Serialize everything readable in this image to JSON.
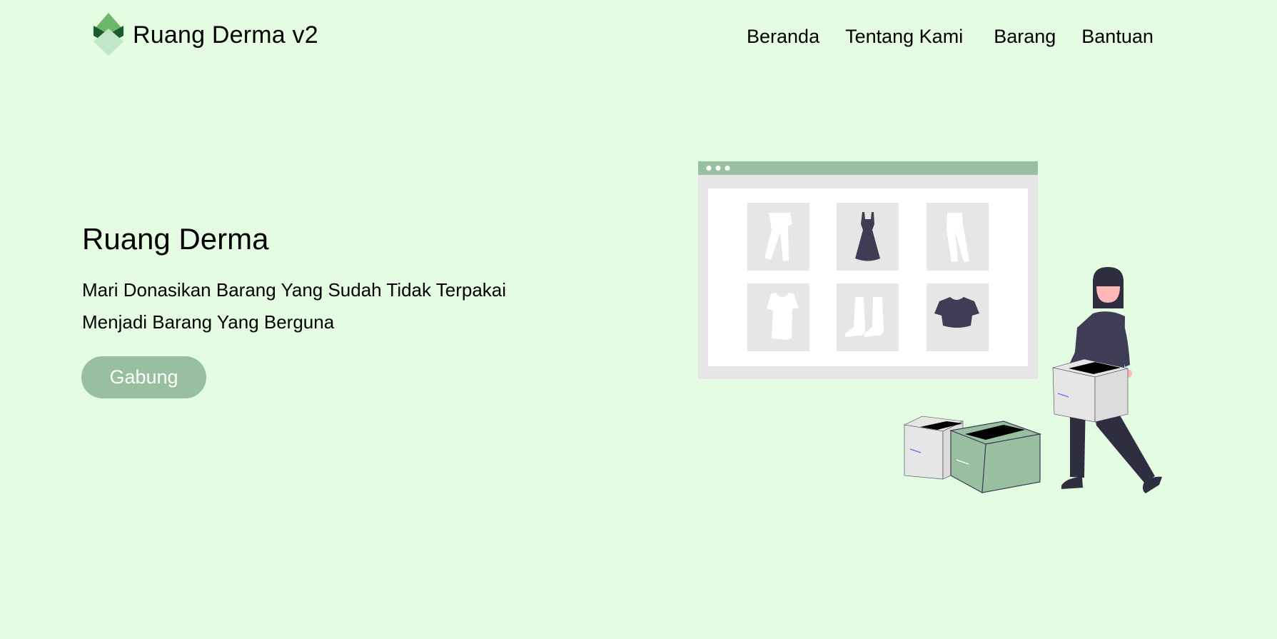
{
  "brand": {
    "name": "Ruang Derma v2",
    "logo_icon": "diamond-logo-icon"
  },
  "nav": {
    "items": [
      {
        "label": "Beranda"
      },
      {
        "label": "Tentang Kami"
      },
      {
        "label": "Barang"
      },
      {
        "label": "Bantuan"
      }
    ]
  },
  "hero": {
    "title": "Ruang Derma",
    "subtitle": "Mari  Donasikan Barang Yang Sudah Tidak Terpakai Menjadi Barang Yang Berguna",
    "cta_label": "Gabung"
  },
  "illustration": {
    "items": [
      "pants-icon",
      "dress-icon",
      "trousers-icon",
      "tshirt-icon",
      "boots-icon",
      "crop-top-icon"
    ]
  },
  "colors": {
    "background": "#e4fde2",
    "accent": "#98bf9f",
    "dark": "#3f3d56"
  }
}
